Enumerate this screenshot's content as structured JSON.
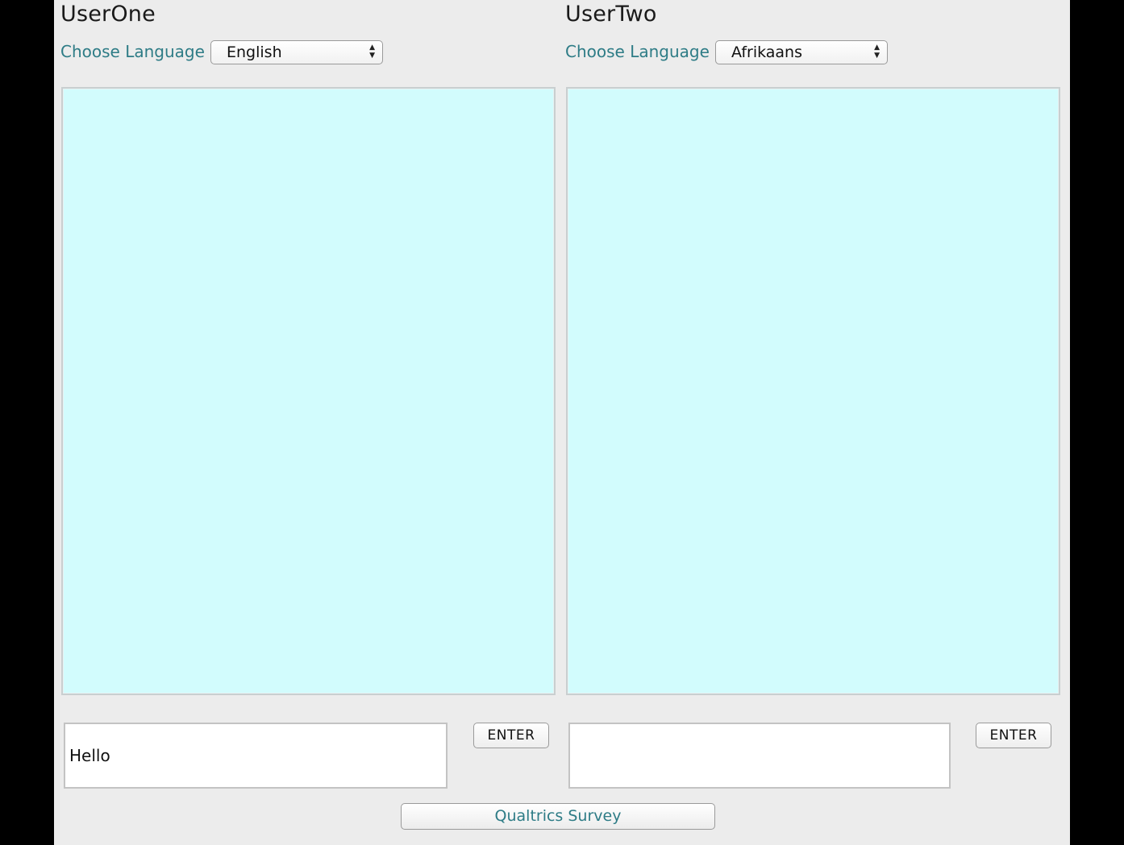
{
  "user_one": {
    "title": "UserOne",
    "language_label": "Choose Language",
    "language_selected": "English",
    "input_value": "Hello",
    "enter_label": "ENTER"
  },
  "user_two": {
    "title": "UserTwo",
    "language_label": "Choose Language",
    "language_selected": "Afrikaans",
    "input_value": "",
    "enter_label": "ENTER"
  },
  "survey_button_label": "Qualtrics Survey",
  "colors": {
    "chat_panel_bg": "#d2fcfd",
    "accent_text": "#2e7c86",
    "window_bg": "#ececec"
  }
}
